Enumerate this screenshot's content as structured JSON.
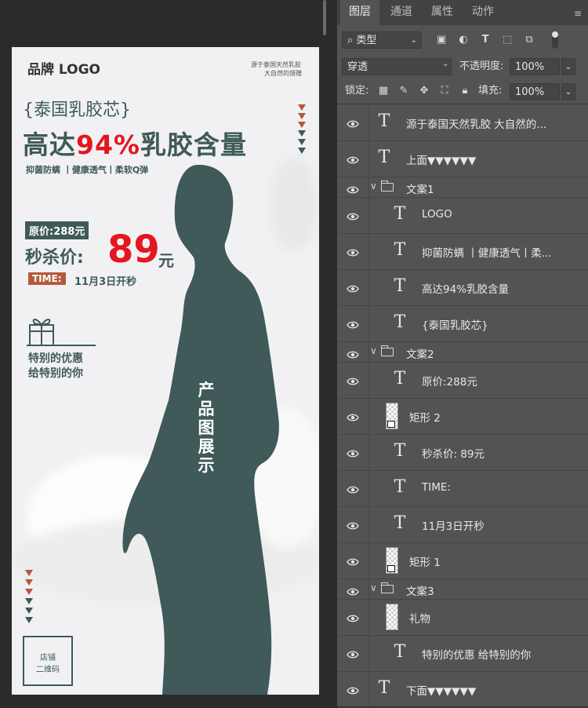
{
  "panel": {
    "tabs": [
      "图层",
      "通道",
      "属性",
      "动作"
    ],
    "filter": {
      "kind_label": "类型"
    },
    "blend": {
      "mode": "穿透",
      "opacity_label": "不透明度:",
      "opacity_value": "100%"
    },
    "lock": {
      "label": "锁定:",
      "fill_label": "填充:",
      "fill_value": "100%"
    },
    "layers": [
      {
        "type": "text",
        "indent": 0,
        "name": "源于泰国天然乳胶 大自然的..."
      },
      {
        "type": "text",
        "indent": 0,
        "name": "上面▼▼▼▼▼▼"
      },
      {
        "type": "group",
        "name": "文案1"
      },
      {
        "type": "text",
        "indent": 1,
        "name": "LOGO"
      },
      {
        "type": "text",
        "indent": 1,
        "name": "抑菌防螨 丨健康透气丨柔..."
      },
      {
        "type": "text",
        "indent": 1,
        "name": "高达94%乳胶含量"
      },
      {
        "type": "text",
        "indent": 1,
        "name": "{泰国乳胶芯}"
      },
      {
        "type": "group",
        "name": "文案2"
      },
      {
        "type": "text",
        "indent": 1,
        "name": "原价:288元"
      },
      {
        "type": "shape",
        "indent": 1,
        "name": "矩形 2"
      },
      {
        "type": "text",
        "indent": 1,
        "name": "秒杀价: 89元"
      },
      {
        "type": "text",
        "indent": 1,
        "name": "TIME:"
      },
      {
        "type": "text",
        "indent": 1,
        "name": "11月3日开秒"
      },
      {
        "type": "shape",
        "indent": 1,
        "name": "矩形 1"
      },
      {
        "type": "group",
        "name": "文案3"
      },
      {
        "type": "image",
        "indent": 1,
        "name": "礼物"
      },
      {
        "type": "text",
        "indent": 1,
        "name": "特别的优惠 给特别的你"
      },
      {
        "type": "text",
        "indent": 0,
        "name": "下面▼▼▼▼▼▼"
      }
    ]
  },
  "poster": {
    "logo": "品牌 LOGO",
    "tagline_1": "源于泰国天然乳胶",
    "tagline_2": "大自然的馈赠",
    "headline_small": "{泰国乳胶芯}",
    "headline_prefix": "高达",
    "headline_highlight": "94%",
    "headline_suffix": "乳胶含量",
    "features": "抑菌防螨 丨健康透气丨柔软Q弹",
    "original_price": "原价:288元",
    "sale_label": "秒杀价:",
    "sale_price": "89",
    "sale_unit": "元",
    "time_label": "TIME:",
    "time_value": "11月3日开秒",
    "gift_line_1": "特别的优惠",
    "gift_line_2": "给特别的你",
    "product_caption": "产品图展示",
    "qr_line_1": "店铺",
    "qr_line_2": "二维码"
  },
  "colors": {
    "dark_teal": "#3f5a58",
    "accent_red": "#e5161f",
    "accent_orange": "#b45a3c",
    "panel_bg": "#535353"
  }
}
